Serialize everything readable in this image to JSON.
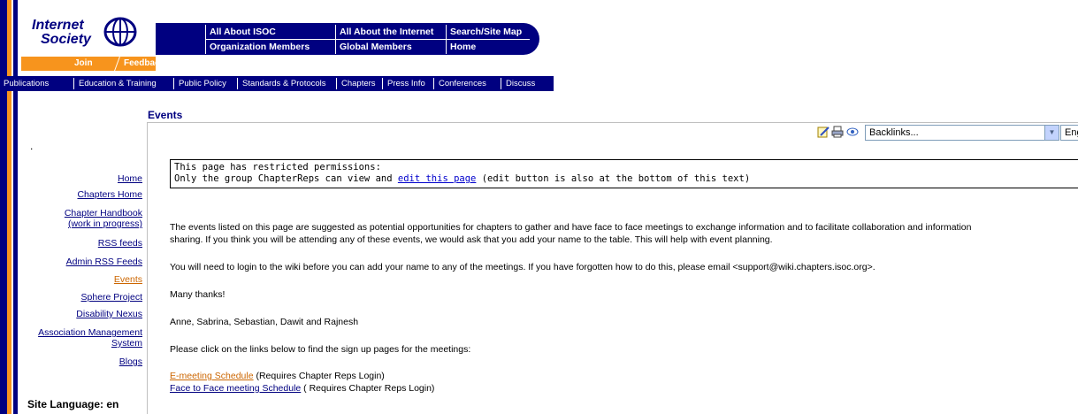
{
  "logo": {
    "line1": "Internet",
    "line2": "Society",
    "join": "Join",
    "feedback": "Feedback"
  },
  "topnav": {
    "col1": [
      "All About ISOC",
      "Organization Members"
    ],
    "col2": [
      "All About the Internet",
      "Global Members"
    ],
    "col3": [
      "Search/Site Map",
      "Home"
    ]
  },
  "navbar": [
    "Publications",
    "Education & Training",
    "Public Policy",
    "Standards & Protocols",
    "Chapters",
    "Press Info",
    "Conferences",
    "Discuss"
  ],
  "sidebar": {
    "dot": ".",
    "items": [
      "Home",
      "Chapters Home",
      "Chapter Handbook",
      "(work in progress)",
      "RSS feeds",
      "Admin RSS Feeds",
      "Events",
      "Sphere Project",
      "Disability Nexus",
      "Association Management",
      "System",
      "Blogs"
    ],
    "site_language": "Site Language: en"
  },
  "main": {
    "title": "Events",
    "backlinks": "Backlinks...",
    "language": "English",
    "notice_line1": "This page has restricted permissions:",
    "notice_line2_pre": "Only the group ChapterReps can view and ",
    "notice_link": "edit this page",
    "notice_line2_post": " (edit button is also at the bottom of this text)",
    "para1_line1": "The events listed on this page are suggested as potential opportunities for chapters to gather and have face to face meetings to exchange information and to facilitate collaboration and information",
    "para1_line2": "sharing. If you think you will be attending any of these events, we would ask that you add your name to the table. This will help with event planning.",
    "para2": "You will need to login to the wiki before you can add your name to any of the meetings. If you have forgotten how to do this, please email <support@wiki.chapters.isoc.org>.",
    "para3": "Many thanks!",
    "para4": "Anne, Sabrina, Sebastian, Dawit and Rajnesh",
    "para5": "Please click on the links below to find the sign up pages for the meetings:",
    "link1": "E-meeting Schedule",
    "link1_note": " (Requires Chapter Reps Login)",
    "link2": "Face to Face meeting Schedule",
    "link2_note": " ( Requires Chapter Reps Login)"
  },
  "colors": {
    "navy": "#000080",
    "orange": "#f7941d"
  }
}
